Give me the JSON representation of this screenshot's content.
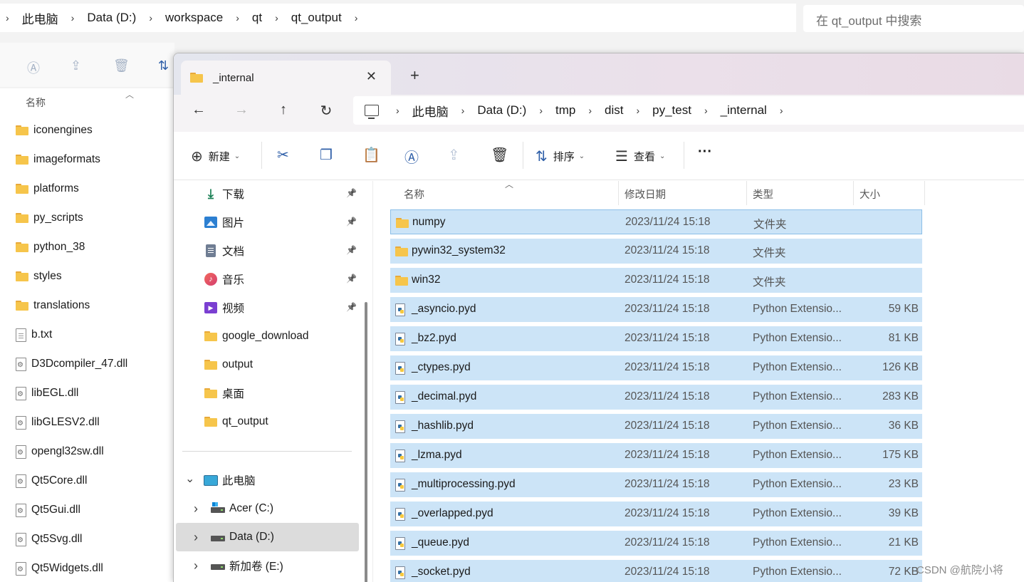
{
  "background_window": {
    "breadcrumbs": [
      "此电脑",
      "Data (D:)",
      "workspace",
      "qt",
      "qt_output"
    ],
    "search_placeholder": "在 qt_output 中搜索",
    "column_name": "名称",
    "items": [
      {
        "name": "iconengines",
        "kind": "folder"
      },
      {
        "name": "imageformats",
        "kind": "folder"
      },
      {
        "name": "platforms",
        "kind": "folder"
      },
      {
        "name": "py_scripts",
        "kind": "folder"
      },
      {
        "name": "python_38",
        "kind": "folder"
      },
      {
        "name": "styles",
        "kind": "folder"
      },
      {
        "name": "translations",
        "kind": "folder"
      },
      {
        "name": "b.txt",
        "kind": "text"
      },
      {
        "name": "D3Dcompiler_47.dll",
        "kind": "dll"
      },
      {
        "name": "libEGL.dll",
        "kind": "dll"
      },
      {
        "name": "libGLESV2.dll",
        "kind": "dll"
      },
      {
        "name": "opengl32sw.dll",
        "kind": "dll"
      },
      {
        "name": "Qt5Core.dll",
        "kind": "dll"
      },
      {
        "name": "Qt5Gui.dll",
        "kind": "dll"
      },
      {
        "name": "Qt5Svg.dll",
        "kind": "dll"
      },
      {
        "name": "Qt5Widgets.dll",
        "kind": "dll"
      }
    ]
  },
  "window": {
    "tab_title": "_internal",
    "breadcrumbs": [
      "此电脑",
      "Data (D:)",
      "tmp",
      "dist",
      "py_test",
      "_internal"
    ],
    "toolbar": {
      "new_label": "新建",
      "sort_label": "排序",
      "view_label": "查看",
      "more_label": "···"
    },
    "icons": {
      "back": "←",
      "forward": "→",
      "up": "↑",
      "refresh": "↻",
      "close": "✕",
      "add_tab": "+",
      "chevron": "›",
      "pin": "📌"
    }
  },
  "nav_pane": {
    "quick_access": [
      {
        "label": "下载",
        "icon": "download-icon",
        "pinned": true
      },
      {
        "label": "图片",
        "icon": "pictures-icon",
        "pinned": true
      },
      {
        "label": "文档",
        "icon": "documents-icon",
        "pinned": true
      },
      {
        "label": "音乐",
        "icon": "music-icon",
        "pinned": true
      },
      {
        "label": "视频",
        "icon": "videos-icon",
        "pinned": true
      },
      {
        "label": "google_download",
        "icon": "folder-icon",
        "pinned": false
      },
      {
        "label": "output",
        "icon": "folder-icon",
        "pinned": false
      },
      {
        "label": "桌面",
        "icon": "folder-icon",
        "pinned": false
      },
      {
        "label": "qt_output",
        "icon": "folder-icon",
        "pinned": false
      }
    ],
    "this_pc": "此电脑",
    "drives": [
      {
        "label": "Acer (C:)"
      },
      {
        "label": "Data (D:)",
        "selected": true
      },
      {
        "label": "新加卷 (E:)"
      }
    ]
  },
  "file_list": {
    "columns": {
      "name": "名称",
      "date": "修改日期",
      "type": "类型",
      "size": "大小"
    },
    "rows": [
      {
        "name": "numpy",
        "date": "2023/11/24 15:18",
        "type": "文件夹",
        "size": "",
        "kind": "folder"
      },
      {
        "name": "pywin32_system32",
        "date": "2023/11/24 15:18",
        "type": "文件夹",
        "size": "",
        "kind": "folder"
      },
      {
        "name": "win32",
        "date": "2023/11/24 15:18",
        "type": "文件夹",
        "size": "",
        "kind": "folder"
      },
      {
        "name": "_asyncio.pyd",
        "date": "2023/11/24 15:18",
        "type": "Python Extensio...",
        "size": "59 KB",
        "kind": "pyd"
      },
      {
        "name": "_bz2.pyd",
        "date": "2023/11/24 15:18",
        "type": "Python Extensio...",
        "size": "81 KB",
        "kind": "pyd"
      },
      {
        "name": "_ctypes.pyd",
        "date": "2023/11/24 15:18",
        "type": "Python Extensio...",
        "size": "126 KB",
        "kind": "pyd"
      },
      {
        "name": "_decimal.pyd",
        "date": "2023/11/24 15:18",
        "type": "Python Extensio...",
        "size": "283 KB",
        "kind": "pyd"
      },
      {
        "name": "_hashlib.pyd",
        "date": "2023/11/24 15:18",
        "type": "Python Extensio...",
        "size": "36 KB",
        "kind": "pyd"
      },
      {
        "name": "_lzma.pyd",
        "date": "2023/11/24 15:18",
        "type": "Python Extensio...",
        "size": "175 KB",
        "kind": "pyd"
      },
      {
        "name": "_multiprocessing.pyd",
        "date": "2023/11/24 15:18",
        "type": "Python Extensio...",
        "size": "23 KB",
        "kind": "pyd"
      },
      {
        "name": "_overlapped.pyd",
        "date": "2023/11/24 15:18",
        "type": "Python Extensio...",
        "size": "39 KB",
        "kind": "pyd"
      },
      {
        "name": "_queue.pyd",
        "date": "2023/11/24 15:18",
        "type": "Python Extensio...",
        "size": "21 KB",
        "kind": "pyd"
      },
      {
        "name": "_socket.pyd",
        "date": "2023/11/24 15:18",
        "type": "Python Extensio...",
        "size": "72 KB",
        "kind": "pyd"
      }
    ]
  },
  "watermark": "CSDN @航院小将",
  "colors": {
    "selection": "#cce4f7",
    "folder": "#f6c54b",
    "accent": "#2f5fa8"
  }
}
